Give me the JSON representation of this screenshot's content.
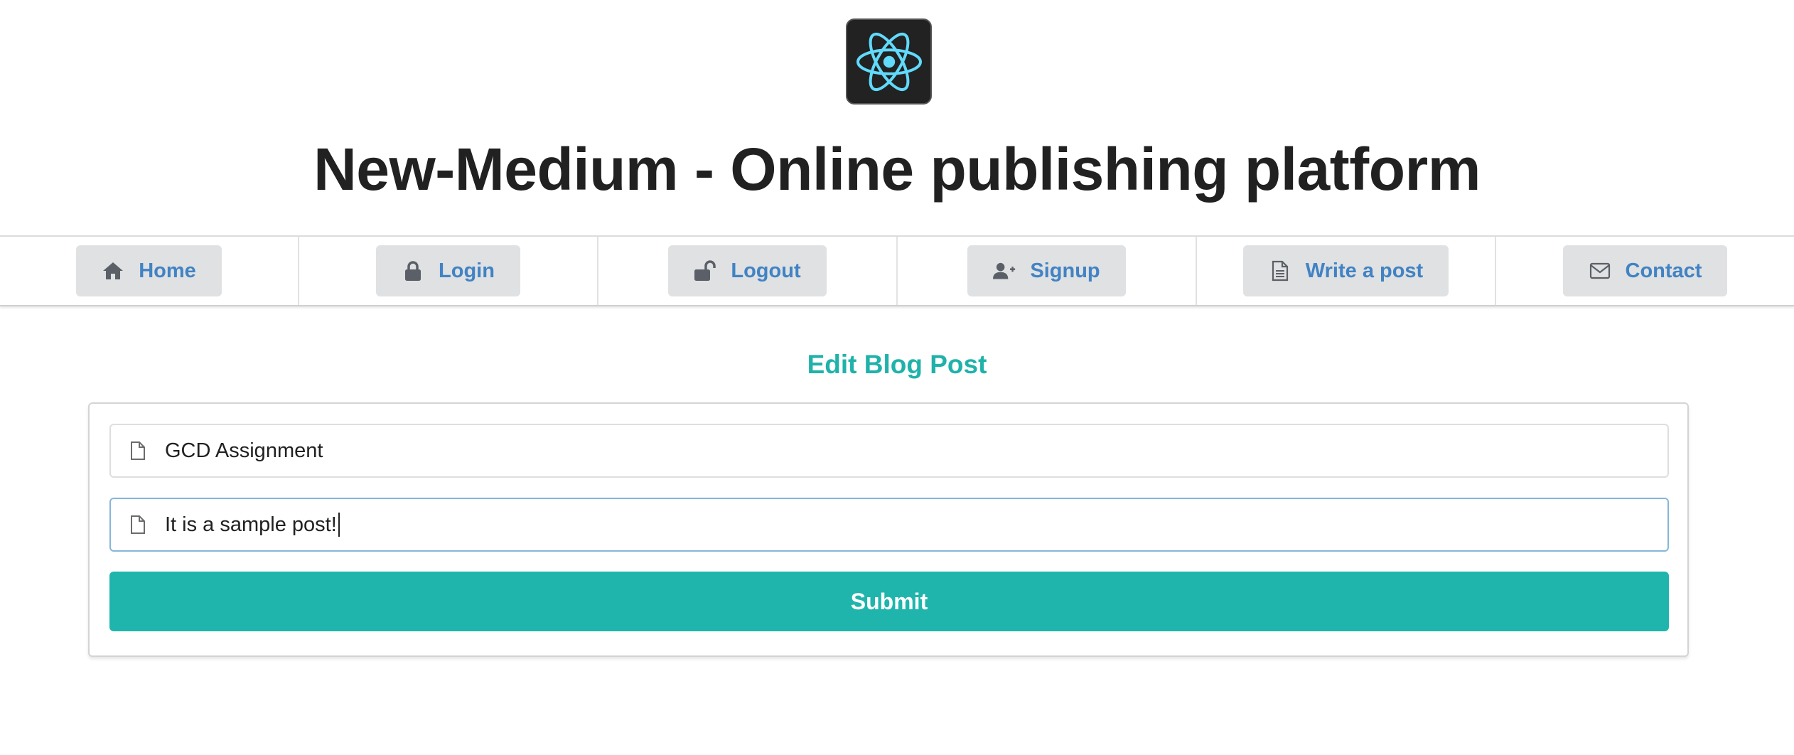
{
  "header": {
    "logo_icon": "react-atom-icon",
    "title": "New-Medium - Online publishing platform"
  },
  "nav": {
    "items": [
      {
        "label": "Home",
        "icon": "home-icon"
      },
      {
        "label": "Login",
        "icon": "lock-icon"
      },
      {
        "label": "Logout",
        "icon": "unlock-icon"
      },
      {
        "label": "Signup",
        "icon": "add-user-icon"
      },
      {
        "label": "Write a post",
        "icon": "file-text-icon"
      },
      {
        "label": "Contact",
        "icon": "envelope-icon"
      }
    ]
  },
  "form": {
    "heading": "Edit Blog Post",
    "title_field": {
      "value": "GCD Assignment",
      "icon": "file-icon"
    },
    "content_field": {
      "value": "It is a sample post!",
      "icon": "file-icon"
    },
    "submit_label": "Submit"
  },
  "colors": {
    "accent_teal": "#20b2aa",
    "nav_link_blue": "#4183c4",
    "nav_button_bg": "#e0e1e2",
    "logo_bg": "#222222",
    "react_blue": "#61dafb"
  }
}
